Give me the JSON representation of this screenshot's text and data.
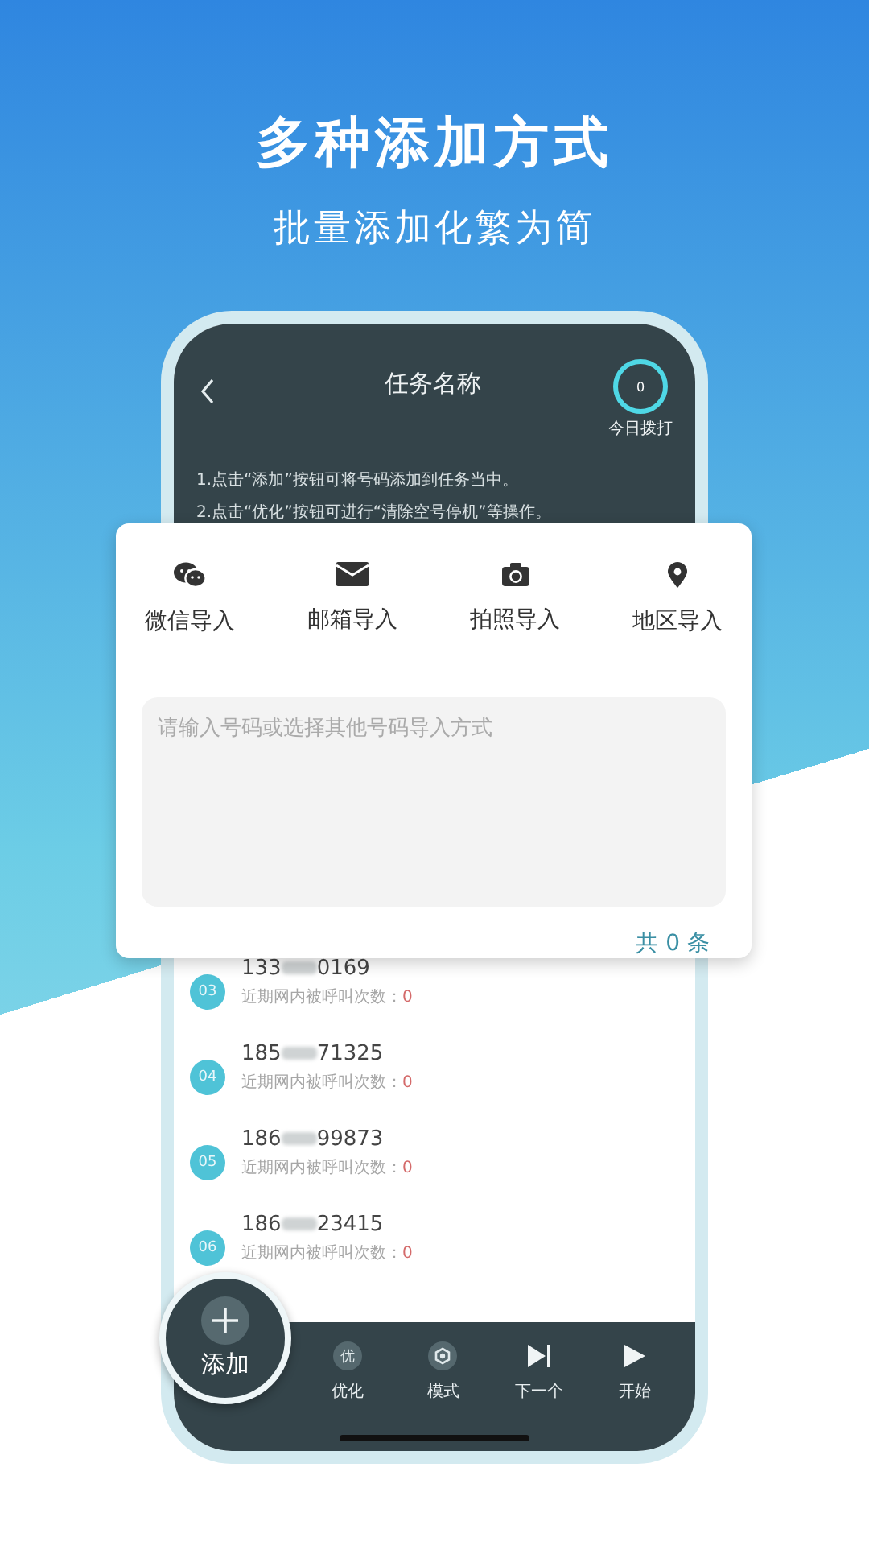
{
  "headline": "多种添加方式",
  "subheadline": "批量添加化繁为简",
  "header": {
    "title": "任务名称",
    "counter": "0",
    "counter_label": "今日拨打"
  },
  "instructions": [
    "1.点击“添加”按钮可将号码添加到任务当中。",
    "2.点击“优化”按钮可进行“清除空号停机”等操作。"
  ],
  "import_card": {
    "options": [
      {
        "kind": "wechat",
        "label": "微信导入"
      },
      {
        "kind": "mail",
        "label": "邮箱导入"
      },
      {
        "kind": "camera",
        "label": "拍照导入"
      },
      {
        "kind": "location",
        "label": "地区导入"
      }
    ],
    "placeholder": "请输入号码或选择其他号码导入方式",
    "total": "共 0 条"
  },
  "rows": [
    {
      "index": "03",
      "prefix": "133",
      "suffix": "0169",
      "calls_label": "近期网内被呼叫次数：",
      "calls": "0"
    },
    {
      "index": "04",
      "prefix": "185",
      "suffix": "71325",
      "calls_label": "近期网内被呼叫次数：",
      "calls": "0"
    },
    {
      "index": "05",
      "prefix": "186",
      "suffix": "99873",
      "calls_label": "近期网内被呼叫次数：",
      "calls": "0"
    },
    {
      "index": "06",
      "prefix": "186",
      "suffix": "23415",
      "calls_label": "近期网内被呼叫次数：",
      "calls": "0"
    }
  ],
  "add_button": {
    "label": "添加"
  },
  "toolbar": [
    {
      "kind": "badge",
      "badge": "优",
      "label": "优化"
    },
    {
      "kind": "mode",
      "label": "模式"
    },
    {
      "kind": "next",
      "label": "下一个"
    },
    {
      "kind": "play",
      "label": "开始"
    }
  ]
}
